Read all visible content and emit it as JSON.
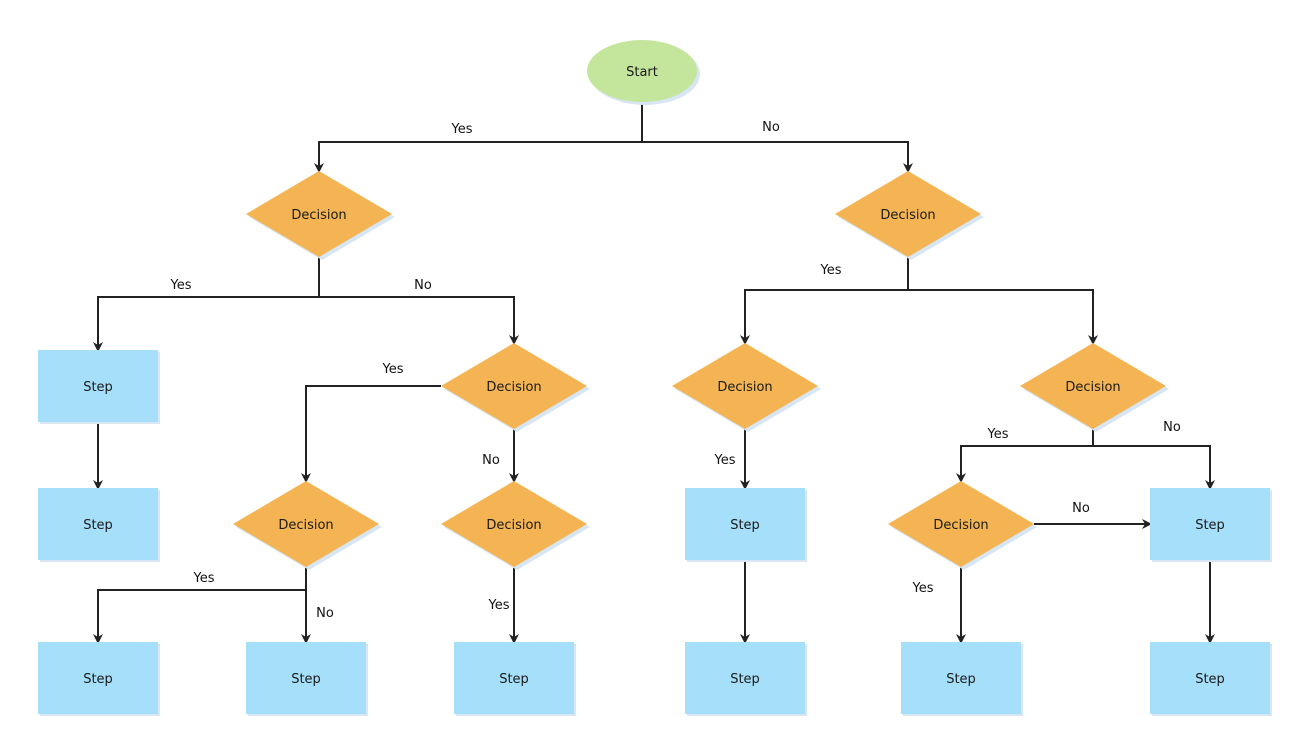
{
  "diagram": {
    "type": "flowchart",
    "colors": {
      "start_fill": "#c4e69c",
      "decision_fill": "#f4b453",
      "step_fill": "#a6dff9",
      "shadow": "#d7e6f2",
      "edge": "#222222",
      "text": "#1a1a1a"
    },
    "nodes": [
      {
        "id": "start",
        "shape": "ellipse",
        "label": "Start"
      },
      {
        "id": "d1",
        "shape": "diamond",
        "label": "Decision"
      },
      {
        "id": "d2",
        "shape": "diamond",
        "label": "Decision"
      },
      {
        "id": "s1",
        "shape": "rect",
        "label": "Step"
      },
      {
        "id": "s2",
        "shape": "rect",
        "label": "Step"
      },
      {
        "id": "d3",
        "shape": "diamond",
        "label": "Decision"
      },
      {
        "id": "d4",
        "shape": "diamond",
        "label": "Decision"
      },
      {
        "id": "d5",
        "shape": "diamond",
        "label": "Decision"
      },
      {
        "id": "s3",
        "shape": "rect",
        "label": "Step"
      },
      {
        "id": "s4",
        "shape": "rect",
        "label": "Step"
      },
      {
        "id": "s5",
        "shape": "rect",
        "label": "Step"
      },
      {
        "id": "d6",
        "shape": "diamond",
        "label": "Decision"
      },
      {
        "id": "d7",
        "shape": "diamond",
        "label": "Decision"
      },
      {
        "id": "s6",
        "shape": "rect",
        "label": "Step"
      },
      {
        "id": "s7",
        "shape": "rect",
        "label": "Step"
      },
      {
        "id": "d8",
        "shape": "diamond",
        "label": "Decision"
      },
      {
        "id": "s8",
        "shape": "rect",
        "label": "Step"
      },
      {
        "id": "s9",
        "shape": "rect",
        "label": "Step"
      },
      {
        "id": "s10",
        "shape": "rect",
        "label": "Step"
      }
    ],
    "edges": [
      {
        "from": "start",
        "to": "d1",
        "label": "Yes"
      },
      {
        "from": "start",
        "to": "d2",
        "label": "No"
      },
      {
        "from": "d1",
        "to": "s1",
        "label": "Yes"
      },
      {
        "from": "d1",
        "to": "d4",
        "label": "No"
      },
      {
        "from": "s1",
        "to": "s2",
        "label": ""
      },
      {
        "from": "d4",
        "to": "d3",
        "label": "Yes"
      },
      {
        "from": "d4",
        "to": "d5",
        "label": "No"
      },
      {
        "from": "d3",
        "to": "s3",
        "label": "Yes"
      },
      {
        "from": "d3",
        "to": "s4",
        "label": "No"
      },
      {
        "from": "d5",
        "to": "s5",
        "label": "Yes"
      },
      {
        "from": "d2",
        "to": "d6",
        "label": "Yes"
      },
      {
        "from": "d2",
        "to": "d7",
        "label": ""
      },
      {
        "from": "d6",
        "to": "s6",
        "label": "Yes"
      },
      {
        "from": "s6",
        "to": "s7",
        "label": ""
      },
      {
        "from": "d7",
        "to": "d8",
        "label": "Yes"
      },
      {
        "from": "d7",
        "to": "s8",
        "label": "No"
      },
      {
        "from": "d8",
        "to": "s8",
        "label": "No"
      },
      {
        "from": "d8",
        "to": "s9",
        "label": "Yes"
      },
      {
        "from": "s8",
        "to": "s10",
        "label": ""
      }
    ]
  }
}
